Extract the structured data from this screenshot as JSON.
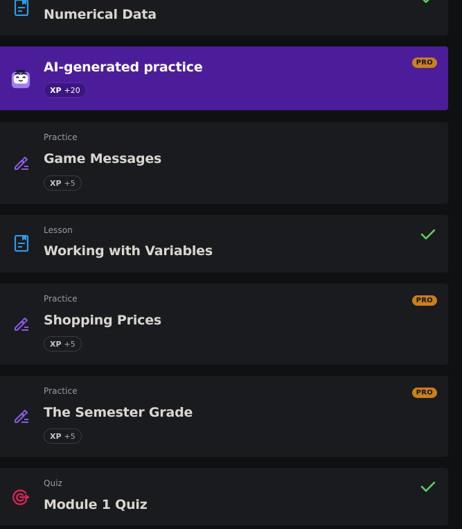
{
  "items": [
    {
      "type": "",
      "title": "Numerical Data",
      "icon": "lesson-icon",
      "completed": true
    },
    {
      "type": "",
      "title": "AI-generated practice",
      "icon": "ai-robot-icon",
      "xp_label": "XP",
      "xp_value": "+20",
      "badge": "PRO"
    },
    {
      "type": "Practice",
      "title": "Game Messages",
      "icon": "practice-pencil-icon",
      "xp_label": "XP",
      "xp_value": "+5"
    },
    {
      "type": "Lesson",
      "title": "Working with Variables",
      "icon": "lesson-icon",
      "completed": true
    },
    {
      "type": "Practice",
      "title": "Shopping Prices",
      "icon": "practice-pencil-icon",
      "xp_label": "XP",
      "xp_value": "+5",
      "badge": "PRO"
    },
    {
      "type": "Practice",
      "title": "The Semester Grade",
      "icon": "practice-pencil-icon",
      "xp_label": "XP",
      "xp_value": "+5",
      "badge": "PRO"
    },
    {
      "type": "Quiz",
      "title": "Module 1 Quiz",
      "icon": "quiz-target-icon",
      "completed": true
    }
  ],
  "colors": {
    "accent_purple": "#4b1d9a",
    "pro_badge": "#c9801c",
    "check_green": "#5fd068",
    "lesson_blue": "#2f9be8",
    "practice_purple": "#8a5be6",
    "quiz_red": "#e8245a"
  }
}
